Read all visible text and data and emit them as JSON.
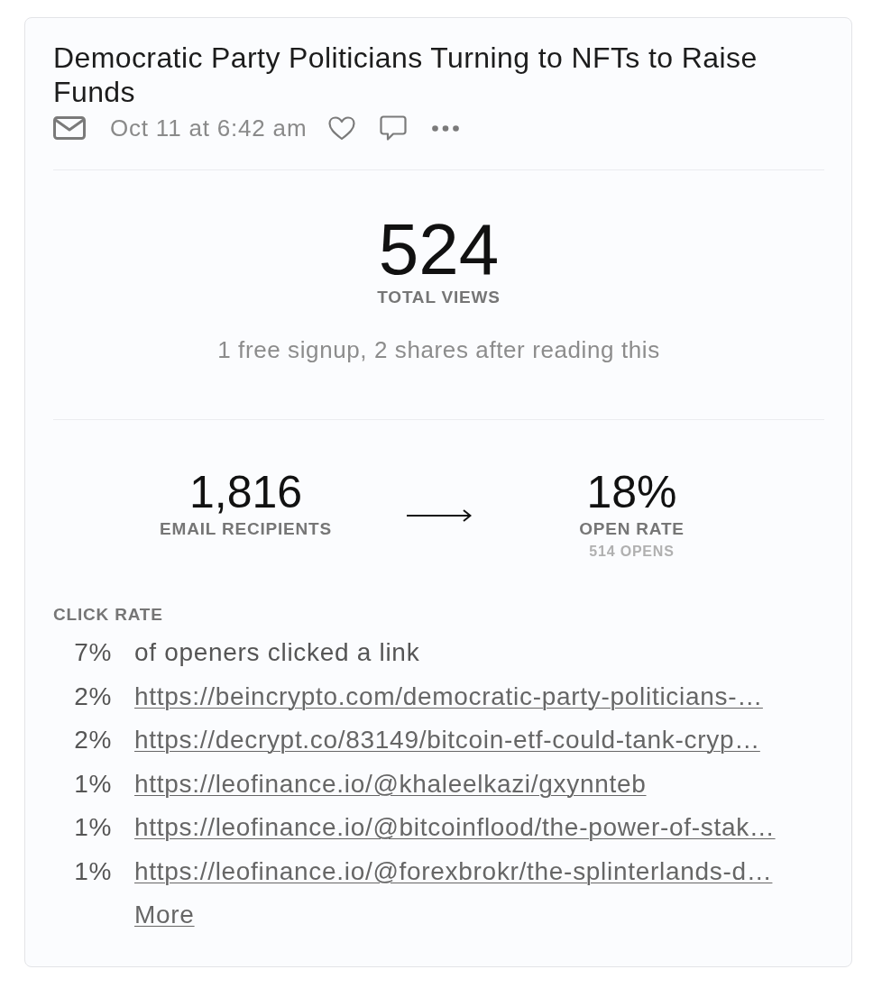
{
  "post": {
    "title": "Democratic Party Politicians Turning to NFTs to Raise Funds",
    "date": "Oct 11 at 6:42 am"
  },
  "views": {
    "value": "524",
    "label": "TOTAL VIEWS",
    "note": "1 free signup, 2 shares after reading this"
  },
  "funnel": {
    "recipients": {
      "value": "1,816",
      "label": "EMAIL RECIPIENTS"
    },
    "open_rate": {
      "value": "18%",
      "label": "OPEN RATE",
      "sublabel": "514 OPENS"
    }
  },
  "click_rate": {
    "heading": "CLICK RATE",
    "rows": [
      {
        "kind": "summary",
        "percent": "7%",
        "text": "of openers clicked a link"
      },
      {
        "kind": "link",
        "percent": "2%",
        "text": "https://beincrypto.com/democratic-party-politicians-…"
      },
      {
        "kind": "link",
        "percent": "2%",
        "text": "https://decrypt.co/83149/bitcoin-etf-could-tank-cryp…"
      },
      {
        "kind": "link",
        "percent": "1%",
        "text": "https://leofinance.io/@khaleelkazi/gxynnteb"
      },
      {
        "kind": "link",
        "percent": "1%",
        "text": "https://leofinance.io/@bitcoinflood/the-power-of-stak…"
      },
      {
        "kind": "link",
        "percent": "1%",
        "text": "https://leofinance.io/@forexbrokr/the-splinterlands-d…"
      }
    ],
    "more": "More"
  }
}
